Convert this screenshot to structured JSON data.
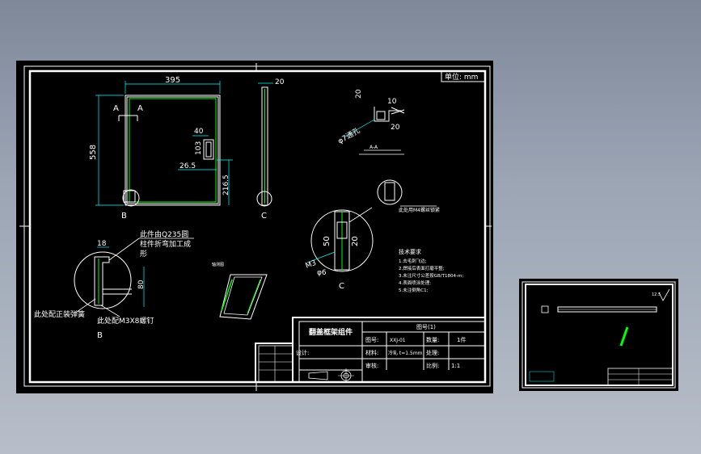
{
  "sheet1": {
    "unit_label": "单位: mm",
    "dims": {
      "width_395": "395",
      "height_558": "558",
      "d40": "40",
      "d103": "103",
      "d26_5": "26.5",
      "d216_5": "216.5",
      "side_20": "20",
      "tr_20a": "20",
      "tr_10": "10",
      "tr_20b": "20",
      "tr_phi": "φ7通孔",
      "c_50": "50",
      "c_20": "20",
      "c_m3": "M3",
      "c_phi6": "φ6",
      "b_18": "18",
      "b_80": "80"
    },
    "section_labels": {
      "a_left": "A",
      "a_right": "A",
      "b": "B",
      "c1": "C",
      "c2": "C",
      "b2": "B",
      "c3": "C",
      "a_sec": "A-A"
    },
    "notes": {
      "n1": "此件由Q235圆",
      "n2": "柱件折弯加工成",
      "n3": "形",
      "n4": "此处配正装弹簧",
      "n5": "此处配M3X8螺钉",
      "n6": "此处用M4螺丝锁紧",
      "iso_caption": "轴测图"
    },
    "tech_req": {
      "title": "技术要求",
      "items": [
        "1.去毛刺飞边;",
        "2.焊接后表面打磨平整;",
        "3.未注尺寸公差按GB/T1804-m;",
        "4.表面喷涂处理;",
        "5.未注倒角C1;"
      ]
    },
    "title_block": {
      "part_name": "翻盖框架组件",
      "drawing_no": "图号(1)",
      "r_figno_label": "图号:",
      "r_figno": "XXJ-01",
      "r_qty_label": "数量:",
      "r_qty": "1件",
      "r_material_label": "材料:",
      "r_material": "冷轧 t=1.5mm",
      "r_treatment_label": "处理:",
      "r_design_label": "设计:",
      "r_check_label": "审核:",
      "r_scale_label": "比例:",
      "r_scale": "1:1"
    }
  },
  "sheet2": {
    "roughness": "12.5"
  },
  "colors": {
    "canvas": "#000000",
    "frame": "#ffffff",
    "geometry": "#ffffff",
    "dimension": "#00ffff",
    "accent": "#00ff00",
    "text": "#ffffff"
  }
}
